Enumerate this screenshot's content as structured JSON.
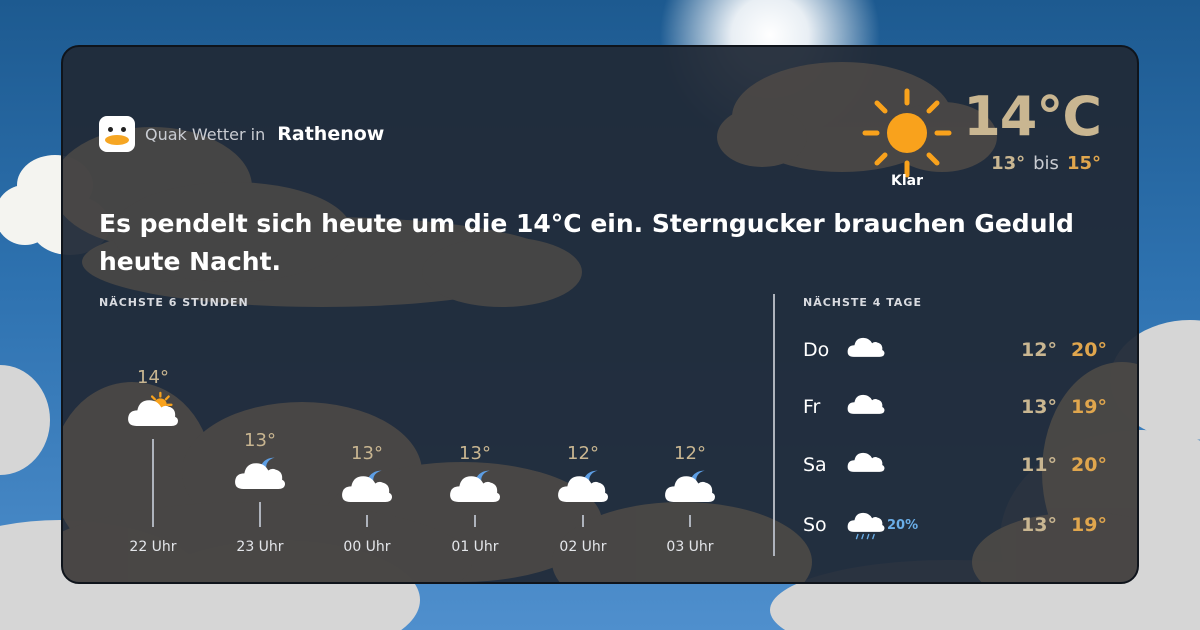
{
  "header": {
    "app_name": "Quak Wetter in",
    "city": "Rathenow"
  },
  "current": {
    "temp": "14°C",
    "condition": "Klar",
    "low": "13°",
    "range_sep": "bis",
    "high": "15°",
    "icon": "sun-icon"
  },
  "summary": "Es pendelt sich heute um die 14°C ein. Sterngucker brauchen Geduld heute Nacht.",
  "hourly": {
    "title": "NÄCHSTE 6 STUNDEN",
    "items": [
      {
        "temp": "14°",
        "time": "22 Uhr",
        "icon": "cloud-sun-icon",
        "level": 14
      },
      {
        "temp": "13°",
        "time": "23 Uhr",
        "icon": "cloud-moon-icon",
        "level": 13
      },
      {
        "temp": "13°",
        "time": "00 Uhr",
        "icon": "cloud-moon-icon",
        "level": 12.8
      },
      {
        "temp": "13°",
        "time": "01 Uhr",
        "icon": "cloud-moon-icon",
        "level": 12.8
      },
      {
        "temp": "12°",
        "time": "02 Uhr",
        "icon": "cloud-moon-icon",
        "level": 12.8
      },
      {
        "temp": "12°",
        "time": "03 Uhr",
        "icon": "cloud-moon-icon",
        "level": 12.8
      }
    ]
  },
  "daily": {
    "title": "NÄCHSTE 4 TAGE",
    "items": [
      {
        "day": "Do",
        "icon": "cloud-icon",
        "low": "12°",
        "high": "20°",
        "precip": ""
      },
      {
        "day": "Fr",
        "icon": "cloud-icon",
        "low": "13°",
        "high": "19°",
        "precip": ""
      },
      {
        "day": "Sa",
        "icon": "cloud-icon",
        "low": "11°",
        "high": "20°",
        "precip": ""
      },
      {
        "day": "So",
        "icon": "cloud-rain-icon",
        "low": "13°",
        "high": "19°",
        "precip": "20%"
      }
    ]
  },
  "colors": {
    "sun": "#f9a21c",
    "moon": "#5d9ee4",
    "temp_low": "#c9b691",
    "temp_high": "#e0a64d",
    "rain": "#6aaee8",
    "card": "#212a38"
  }
}
